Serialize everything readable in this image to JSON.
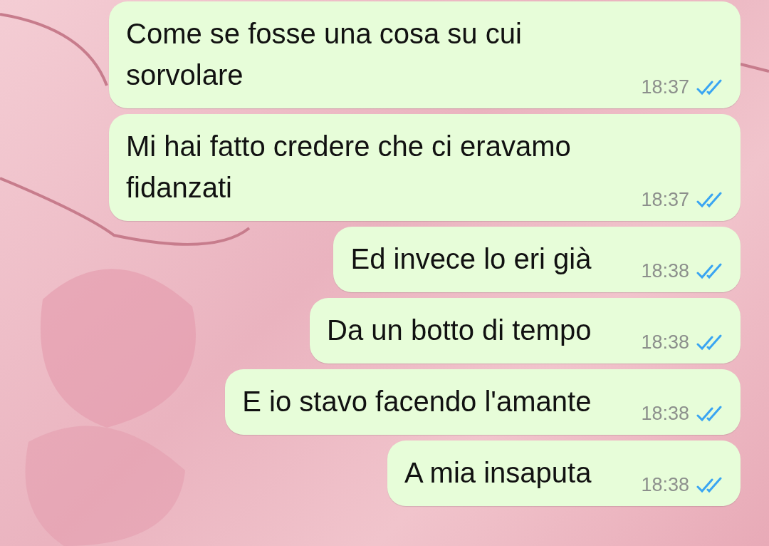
{
  "messages": [
    {
      "text": "Come se fosse una cosa su cui sorvolare",
      "time": "18:37",
      "read": true
    },
    {
      "text": "Mi hai fatto credere che ci eravamo fidanzati",
      "time": "18:37",
      "read": true
    },
    {
      "text": "Ed invece lo eri già",
      "time": "18:38",
      "read": true
    },
    {
      "text": "Da un botto di tempo",
      "time": "18:38",
      "read": true
    },
    {
      "text": "E io stavo facendo l'amante",
      "time": "18:38",
      "read": true
    },
    {
      "text": "A mia insaputa",
      "time": "18:38",
      "read": true
    }
  ]
}
